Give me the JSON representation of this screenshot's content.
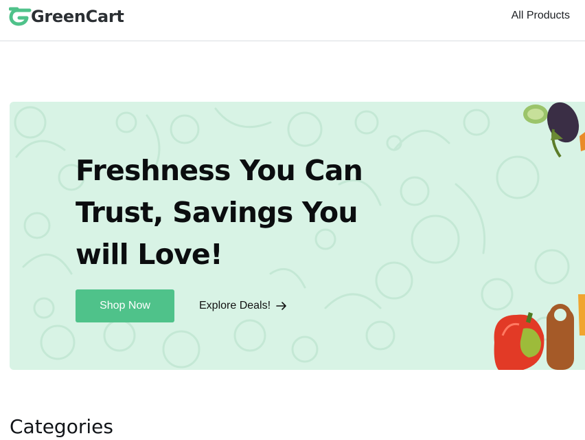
{
  "brand": {
    "name": "GreenCart",
    "logo_icon": "g-leaf-icon",
    "accent_color": "#4fc28a"
  },
  "nav": {
    "all_products_label": "All Products"
  },
  "hero": {
    "title": "Freshness You Can Trust, Savings You will Love!",
    "primary_button_label": "Shop Now",
    "secondary_link_label": "Explore Deals!",
    "secondary_link_icon": "arrow-right-icon",
    "background_color": "#d8f3e5",
    "decor_icons": [
      "cucumber-eggplant-icon",
      "bell-pepper-cutting-board-icon"
    ]
  },
  "categories": {
    "title": "Categories"
  }
}
